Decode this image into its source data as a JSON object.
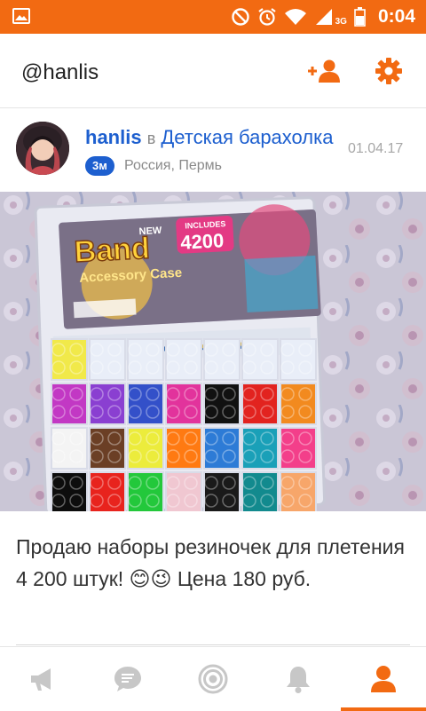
{
  "status_bar": {
    "time": "0:04",
    "network": "3G",
    "icons": [
      "image-icon",
      "do-not-disturb-icon",
      "alarm-icon",
      "wifi-icon",
      "signal-icon",
      "battery-icon"
    ]
  },
  "header": {
    "title": "@hanlis",
    "icons": [
      "add-friend-icon",
      "gear-icon"
    ]
  },
  "post": {
    "author": "hanlis",
    "in_word": "в",
    "group": "Детская барахолка",
    "date": "01.04.17",
    "age_badge": "3м",
    "location": "Россия, Пермь",
    "text": "Продаю наборы резиночек для плетения 4 200 штук! 😊😉 Цена 180 руб."
  },
  "product_box": {
    "brand": "Band",
    "line": "Accessory Case",
    "new_badge": "NEW",
    "includes_label": "INCLUDES",
    "count": "4200"
  },
  "bottom_nav": {
    "items": [
      "megaphone-icon",
      "chat-icon",
      "target-icon",
      "bell-icon",
      "profile-icon"
    ],
    "active_index": 4
  },
  "colors": {
    "accent": "#f26a12",
    "link": "#1d5fcf",
    "inactive_icon": "#c7c7c7"
  }
}
